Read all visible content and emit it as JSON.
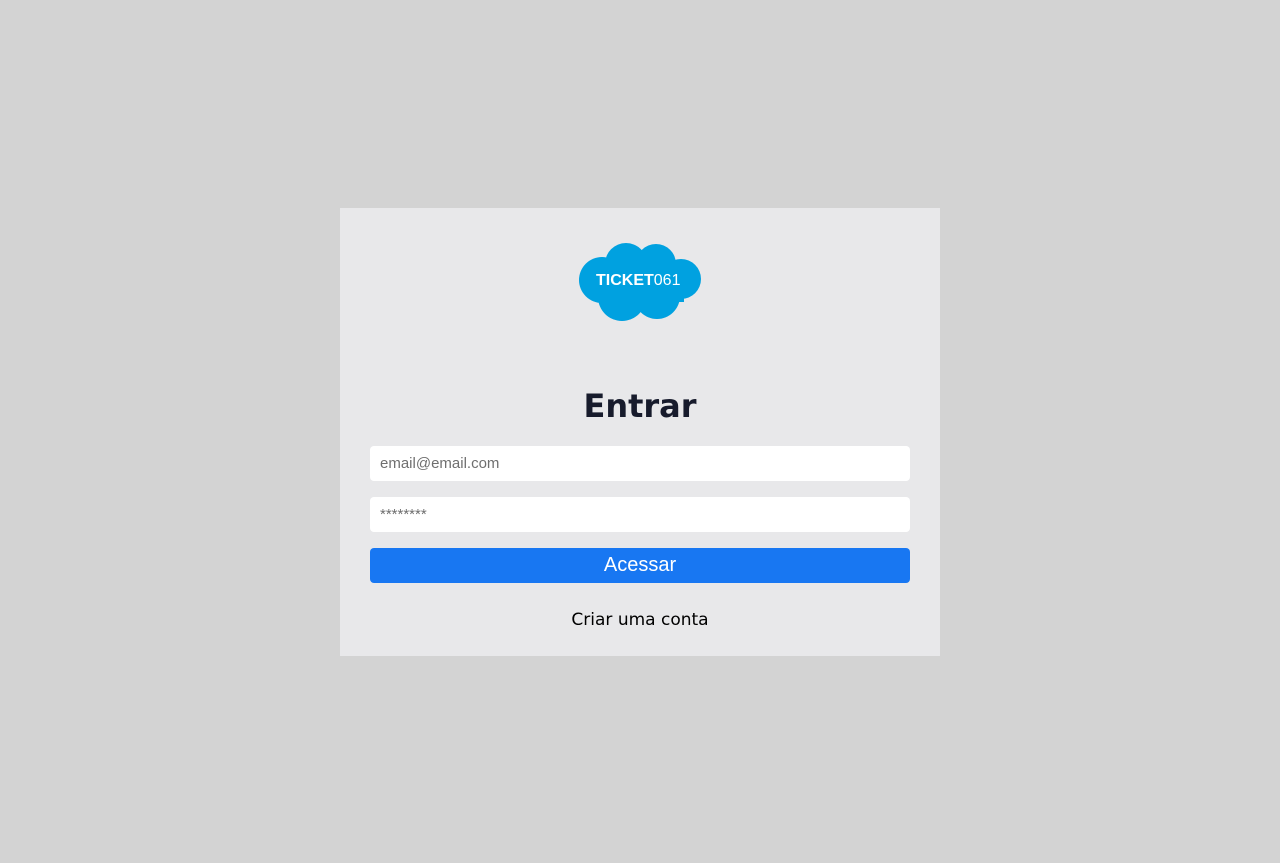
{
  "logo": {
    "text_bold": "TICKET",
    "text_light": "061",
    "color": "#00a1e0",
    "icon": "cloud-logo"
  },
  "login": {
    "title": "Entrar",
    "email_placeholder": "email@email.com",
    "email_value": "",
    "password_placeholder": "********",
    "password_value": "",
    "submit_label": "Acessar",
    "signup_link": "Criar uma conta"
  },
  "colors": {
    "page_background": "#d3d3d3",
    "card_background": "#e8e8ea",
    "button": "#1877f2",
    "title": "#171b2c"
  }
}
